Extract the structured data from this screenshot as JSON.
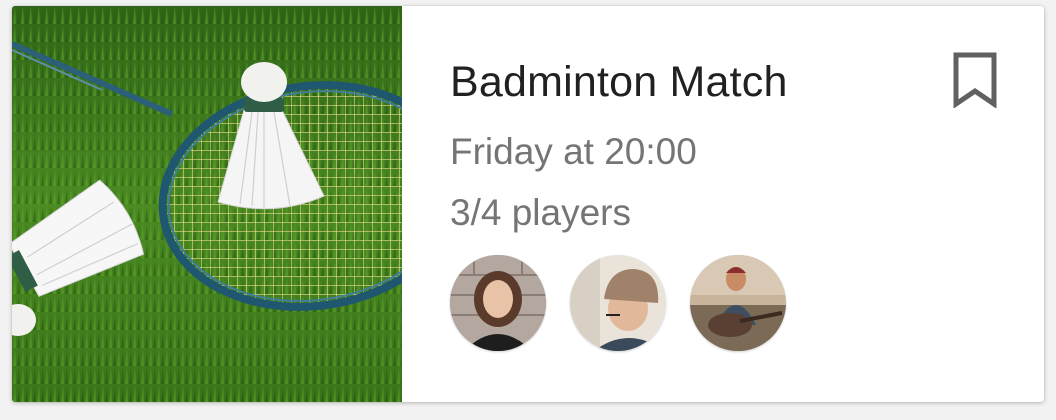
{
  "event": {
    "title": "Badminton Match",
    "time": "Friday at 20:00",
    "players": "3/4 players"
  },
  "image": {
    "subject": "badminton-racket-and-shuttlecocks-on-grass"
  },
  "avatars": [
    {
      "name": "avatar-player-1"
    },
    {
      "name": "avatar-player-2"
    },
    {
      "name": "avatar-player-3"
    }
  ],
  "icons": {
    "bookmark": "bookmark-icon"
  },
  "colors": {
    "title": "#212121",
    "secondary": "#757575",
    "icon": "#616161",
    "grass": "#3f7a1f"
  }
}
